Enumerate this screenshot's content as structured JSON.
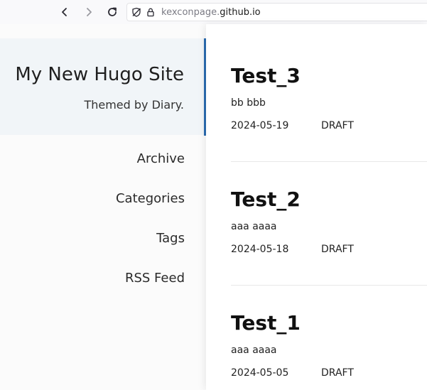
{
  "browser": {
    "url_host_dim": "kexconpage.",
    "url_host": "github.io"
  },
  "site": {
    "title": "My New Hugo Site",
    "subtitle": "Themed by Diary."
  },
  "nav": {
    "items": [
      {
        "label": "Archive"
      },
      {
        "label": "Categories"
      },
      {
        "label": "Tags"
      },
      {
        "label": "RSS Feed"
      }
    ]
  },
  "posts": [
    {
      "title": "Test_3",
      "excerpt": "bb bbb",
      "date": "2024-05-19",
      "status": "DRAFT"
    },
    {
      "title": "Test_2",
      "excerpt": "aaa aaaa",
      "date": "2024-05-18",
      "status": "DRAFT"
    },
    {
      "title": "Test_1",
      "excerpt": "aaa aaaa",
      "date": "2024-05-05",
      "status": "DRAFT"
    }
  ],
  "icons": {
    "back": "chevron-left-icon",
    "forward": "chevron-right-icon",
    "reload": "reload-icon",
    "tracking": "tracking-protection-icon",
    "lock": "lock-icon"
  }
}
